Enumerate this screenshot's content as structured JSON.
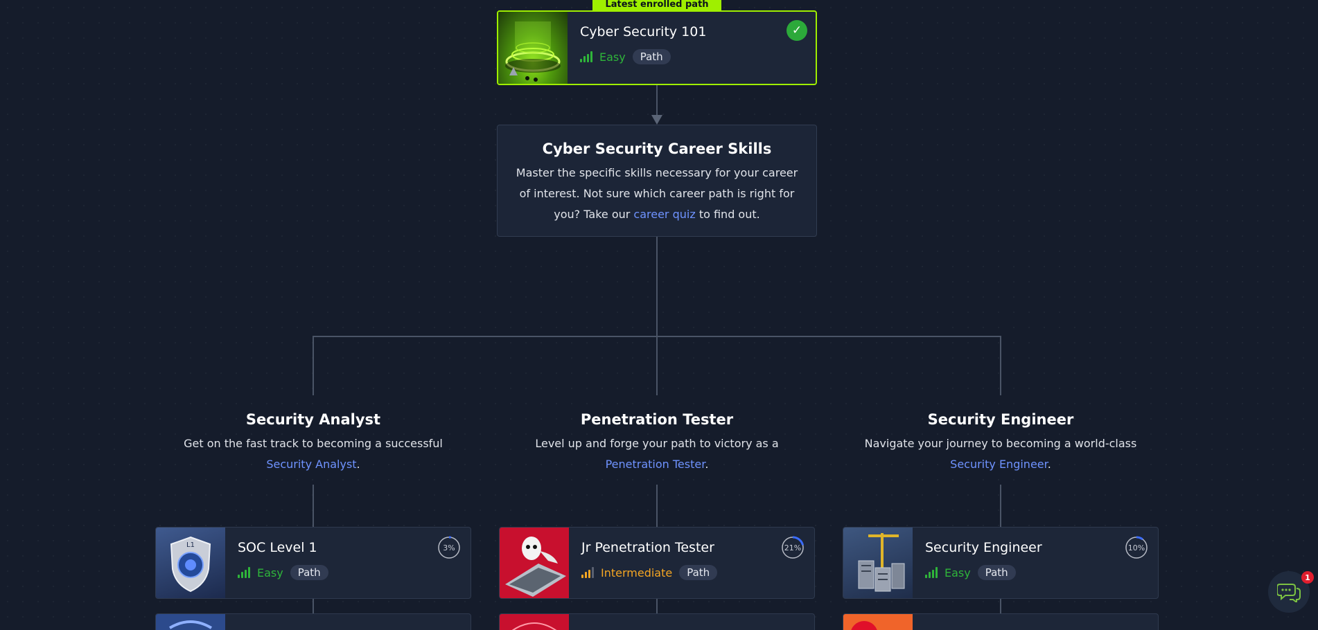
{
  "enrolled": {
    "tag": "Latest enrolled path",
    "title": "Cyber Security 101",
    "difficulty": "Easy",
    "type": "Path",
    "completed": true
  },
  "career": {
    "title": "Cyber Security Career Skills",
    "text_before": "Master the specific skills necessary for your career of interest. Not sure which career path is right for you? Take our ",
    "link": "career quiz",
    "text_after": " to find out."
  },
  "roles": [
    {
      "title": "Security Analyst",
      "desc_before": "Get on the fast track to becoming a successful ",
      "link": "Security Analyst",
      "desc_after": "."
    },
    {
      "title": "Penetration Tester",
      "desc_before": "Level up and forge your path to victory as a ",
      "link": "Penetration Tester",
      "desc_after": "."
    },
    {
      "title": "Security Engineer",
      "desc_before": "Navigate your journey to becoming a world-class ",
      "link": "Security Engineer",
      "desc_after": "."
    }
  ],
  "paths": [
    {
      "title": "SOC Level 1",
      "difficulty": "Easy",
      "type": "Path",
      "progress": "3%",
      "progress_value": 3
    },
    {
      "title": "Jr Penetration Tester",
      "difficulty": "Intermediate",
      "type": "Path",
      "progress": "21%",
      "progress_value": 21
    },
    {
      "title": "Security Engineer",
      "difficulty": "Easy",
      "type": "Path",
      "progress": "10%",
      "progress_value": 10
    }
  ],
  "chat": {
    "badge": "1"
  },
  "colors": {
    "accent": "#9fef00",
    "easy": "#2fb53a",
    "intermediate": "#f5a623",
    "link": "#6f93ff",
    "progress": "#3b6cff"
  }
}
